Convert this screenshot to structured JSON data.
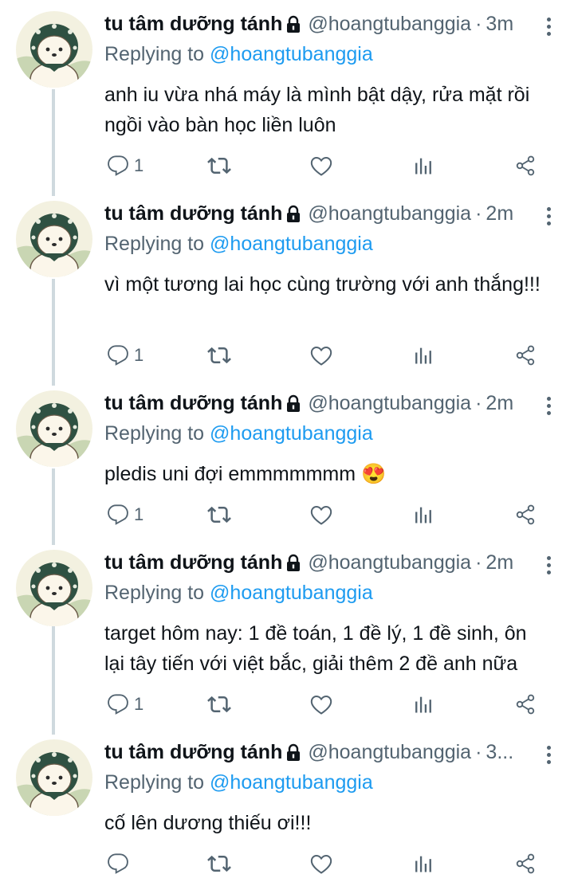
{
  "tweets": [
    {
      "name": "tu tâm dưỡng tánh",
      "handle": "@hoangtubanggia",
      "time": "3m",
      "replying_prefix": "Replying to",
      "replying_to": "@hoangtubanggia",
      "text": "anh iu vừa nhá máy là mình bật dậy, rửa mặt rồi ngồi vào bàn học liền luôn",
      "reply_count": "1"
    },
    {
      "name": "tu tâm dưỡng tánh",
      "handle": "@hoangtubanggia",
      "time": "2m",
      "replying_prefix": "Replying to",
      "replying_to": "@hoangtubanggia",
      "text": "vì một tương lai học cùng trường với anh thắng!!!",
      "reply_count": "1"
    },
    {
      "name": "tu tâm dưỡng tánh",
      "handle": "@hoangtubanggia",
      "time": "2m",
      "replying_prefix": "Replying to",
      "replying_to": "@hoangtubanggia",
      "text": "pledis uni đợi emmmmmmm 😍",
      "reply_count": "1"
    },
    {
      "name": "tu tâm dưỡng tánh",
      "handle": "@hoangtubanggia",
      "time": "2m",
      "replying_prefix": "Replying to",
      "replying_to": "@hoangtubanggia",
      "text": "target hôm nay: 1 đề toán, 1 đề lý, 1 đề sinh, ôn lại tây tiến với việt bắc, giải thêm 2 đề anh nữa",
      "reply_count": "1"
    },
    {
      "name": "tu tâm dưỡng tánh",
      "handle": "@hoangtubanggia",
      "time": "3...",
      "replying_prefix": "Replying to",
      "replying_to": "@hoangtubanggia",
      "text": "cố lên dương thiếu ơi!!!",
      "reply_count": ""
    }
  ],
  "icons": {
    "reply": "reply-icon",
    "retweet": "retweet-icon",
    "like": "heart-icon",
    "views": "analytics-icon",
    "share": "share-icon",
    "lock": "lock-icon",
    "more": "more-vertical-icon"
  },
  "colors": {
    "name": "#0f1419",
    "muted": "#536471",
    "link": "#1d9bf0",
    "avatar_bg": "#f3f1e0"
  }
}
